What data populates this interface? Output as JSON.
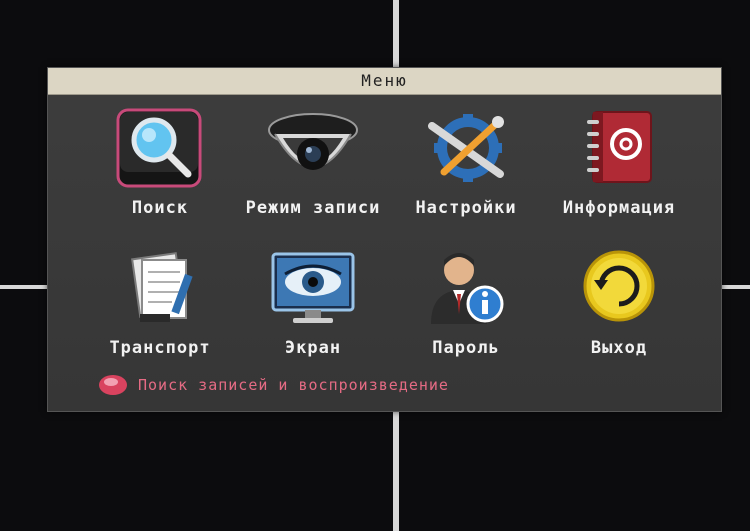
{
  "window": {
    "title": "Меню"
  },
  "menu": {
    "items": [
      {
        "id": "search",
        "label": "Поиск",
        "icon": "search-icon"
      },
      {
        "id": "record-mode",
        "label": "Режим записи",
        "icon": "camera-dome-icon"
      },
      {
        "id": "settings",
        "label": "Настройки",
        "icon": "tools-icon"
      },
      {
        "id": "info",
        "label": "Информация",
        "icon": "address-book-icon"
      },
      {
        "id": "transport",
        "label": "Транспорт",
        "icon": "notepad-icon"
      },
      {
        "id": "screen",
        "label": "Экран",
        "icon": "monitor-eye-icon"
      },
      {
        "id": "password",
        "label": "Пароль",
        "icon": "user-info-icon"
      },
      {
        "id": "exit",
        "label": "Выход",
        "icon": "refresh-exit-icon"
      }
    ]
  },
  "status": {
    "text": "Поиск записей и воспроизведение",
    "color": "#e56b84"
  },
  "colors": {
    "titlebar": "#dcd6c4",
    "window_bg": "#3a3a3a",
    "label_text": "#f2f2f2"
  }
}
